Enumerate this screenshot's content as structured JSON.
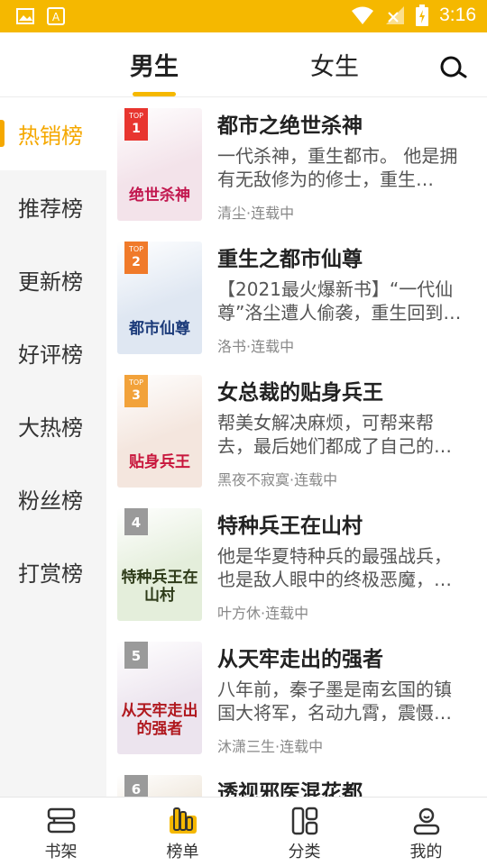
{
  "status": {
    "time": "3:16"
  },
  "header": {
    "tabs": [
      {
        "label": "男生",
        "active": true
      },
      {
        "label": "女生",
        "active": false
      }
    ]
  },
  "sidebar": {
    "items": [
      {
        "label": "热销榜",
        "active": true
      },
      {
        "label": "推荐榜"
      },
      {
        "label": "更新榜"
      },
      {
        "label": "好评榜"
      },
      {
        "label": "大热榜"
      },
      {
        "label": "粉丝榜"
      },
      {
        "label": "打赏榜"
      }
    ]
  },
  "books": [
    {
      "rank": "1",
      "rank_prefix": "TOP",
      "title": "都市之绝世杀神",
      "desc": "一代杀神，重生都市。 他是拥有无敌修为的修士，重生…",
      "meta": "清尘·连载中",
      "cover_text": "绝世杀神",
      "cover_bg": "#f3e3ea",
      "cover_accent": "#c2184f",
      "badge_color": "#e8352f"
    },
    {
      "rank": "2",
      "rank_prefix": "TOP",
      "title": "重生之都市仙尊",
      "desc": "【2021最火爆新书】“一代仙尊”洛尘遭人偷袭，重生回到…",
      "meta": "洛书·连载中",
      "cover_text": "都市仙尊",
      "cover_bg": "#dfe7f2",
      "cover_accent": "#1c3b7a",
      "badge_color": "#f07a2a"
    },
    {
      "rank": "3",
      "rank_prefix": "TOP",
      "title": "女总裁的贴身兵王",
      "desc": "帮美女解决麻烦，可帮来帮去，最后她们都成了自己的…",
      "meta": "黑夜不寂寞·连载中",
      "cover_text": "贴身兵王",
      "cover_bg": "#f4e6de",
      "cover_accent": "#c8163c",
      "badge_color": "#f2a23a"
    },
    {
      "rank": "4",
      "title": "特种兵王在山村",
      "desc": "他是华夏特种兵的最强战兵，也是敌人眼中的终极恶魔，…",
      "meta": "叶方休·连载中",
      "cover_text": "特种兵王在山村",
      "cover_bg": "#e4eedb",
      "cover_accent": "#2d3a18",
      "badge_color": "#9a9a9a"
    },
    {
      "rank": "5",
      "title": "从天牢走出的强者",
      "desc": "八年前，秦子墨是南玄国的镇国大将军，名动九霄，震慑…",
      "meta": "沐潇三生·连载中",
      "cover_text": "从天牢走出的强者",
      "cover_bg": "#ece4ee",
      "cover_accent": "#b0181e",
      "badge_color": "#9a9a9a"
    },
    {
      "rank": "6",
      "title": "透视邪医混花都",
      "desc": "",
      "meta": "",
      "cover_text": "",
      "cover_bg": "#eadfcf",
      "cover_accent": "#6a4a2a",
      "badge_color": "#9a9a9a"
    }
  ],
  "bottom_nav": [
    {
      "label": "书架",
      "icon": "bookshelf-icon",
      "active": false
    },
    {
      "label": "榜单",
      "icon": "ranking-icon",
      "active": true
    },
    {
      "label": "分类",
      "icon": "category-icon",
      "active": false
    },
    {
      "label": "我的",
      "icon": "profile-icon",
      "active": false
    }
  ],
  "colors": {
    "accent": "#f5b800",
    "accent_text": "#f5a800"
  }
}
